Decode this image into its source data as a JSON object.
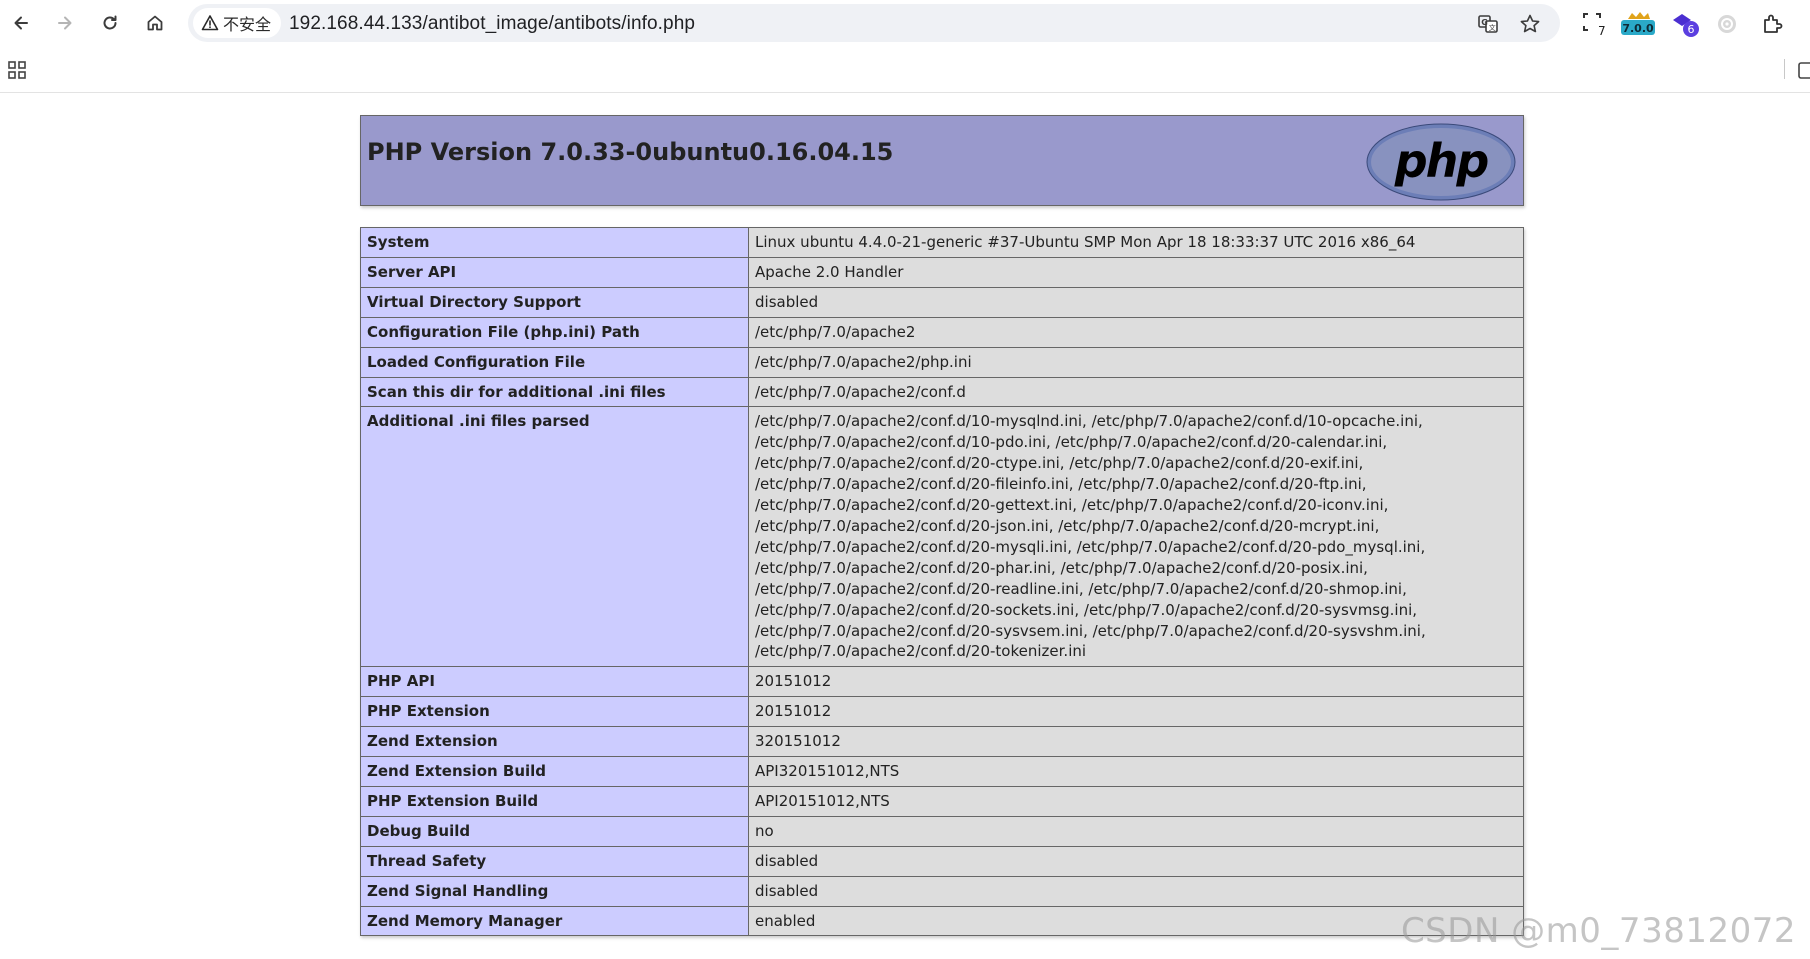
{
  "browser": {
    "security_label": "不安全",
    "url": "192.168.44.133/antibot_image/antibots/info.php",
    "extensions": [
      {
        "name": "ext-1",
        "badge": "7"
      },
      {
        "name": "ext-2",
        "badge": "7.0.0"
      },
      {
        "name": "ext-3",
        "badge": "6"
      }
    ]
  },
  "php": {
    "title": "PHP Version 7.0.33-0ubuntu0.16.04.15",
    "logo_text": "php",
    "rows": [
      {
        "key": "System",
        "value": "Linux ubuntu 4.4.0-21-generic #37-Ubuntu SMP Mon Apr 18 18:33:37 UTC 2016 x86_64"
      },
      {
        "key": "Server API",
        "value": "Apache 2.0 Handler"
      },
      {
        "key": "Virtual Directory Support",
        "value": "disabled"
      },
      {
        "key": "Configuration File (php.ini) Path",
        "value": "/etc/php/7.0/apache2"
      },
      {
        "key": "Loaded Configuration File",
        "value": "/etc/php/7.0/apache2/php.ini"
      },
      {
        "key": "Scan this dir for additional .ini files",
        "value": "/etc/php/7.0/apache2/conf.d"
      },
      {
        "key": "Additional .ini files parsed",
        "lines": [
          "/etc/php/7.0/apache2/conf.d/10-mysqlnd.ini, /etc/php/7.0/apache2/conf.d/10-opcache.ini,",
          "/etc/php/7.0/apache2/conf.d/10-pdo.ini, /etc/php/7.0/apache2/conf.d/20-calendar.ini,",
          "/etc/php/7.0/apache2/conf.d/20-ctype.ini, /etc/php/7.0/apache2/conf.d/20-exif.ini,",
          "/etc/php/7.0/apache2/conf.d/20-fileinfo.ini, /etc/php/7.0/apache2/conf.d/20-ftp.ini,",
          "/etc/php/7.0/apache2/conf.d/20-gettext.ini, /etc/php/7.0/apache2/conf.d/20-iconv.ini,",
          "/etc/php/7.0/apache2/conf.d/20-json.ini, /etc/php/7.0/apache2/conf.d/20-mcrypt.ini,",
          "/etc/php/7.0/apache2/conf.d/20-mysqli.ini, /etc/php/7.0/apache2/conf.d/20-pdo_mysql.ini,",
          "/etc/php/7.0/apache2/conf.d/20-phar.ini, /etc/php/7.0/apache2/conf.d/20-posix.ini,",
          "/etc/php/7.0/apache2/conf.d/20-readline.ini, /etc/php/7.0/apache2/conf.d/20-shmop.ini,",
          "/etc/php/7.0/apache2/conf.d/20-sockets.ini, /etc/php/7.0/apache2/conf.d/20-sysvmsg.ini,",
          "/etc/php/7.0/apache2/conf.d/20-sysvsem.ini, /etc/php/7.0/apache2/conf.d/20-sysvshm.ini,",
          "/etc/php/7.0/apache2/conf.d/20-tokenizer.ini"
        ]
      },
      {
        "key": "PHP API",
        "value": "20151012"
      },
      {
        "key": "PHP Extension",
        "value": "20151012"
      },
      {
        "key": "Zend Extension",
        "value": "320151012"
      },
      {
        "key": "Zend Extension Build",
        "value": "API320151012,NTS"
      },
      {
        "key": "PHP Extension Build",
        "value": "API20151012,NTS"
      },
      {
        "key": "Debug Build",
        "value": "no"
      },
      {
        "key": "Thread Safety",
        "value": "disabled"
      },
      {
        "key": "Zend Signal Handling",
        "value": "disabled"
      },
      {
        "key": "Zend Memory Manager",
        "value": "enabled"
      }
    ]
  },
  "watermark": "CSDN @m0_73812072",
  "colors": {
    "header_bg": "#9999cc",
    "key_bg": "#ccccff",
    "value_bg": "#dddddd"
  }
}
